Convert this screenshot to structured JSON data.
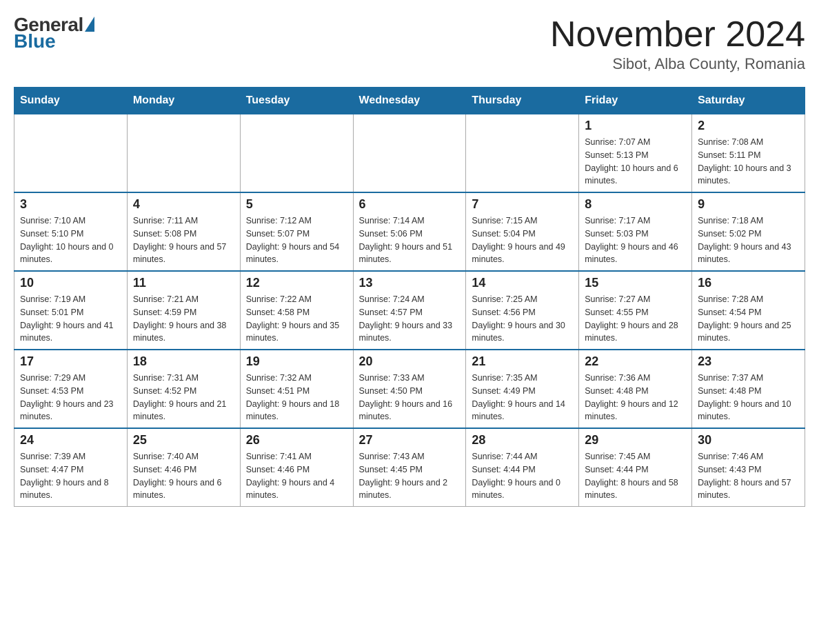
{
  "logo": {
    "general": "General",
    "blue": "Blue"
  },
  "title": {
    "month": "November 2024",
    "location": "Sibot, Alba County, Romania"
  },
  "weekdays": [
    "Sunday",
    "Monday",
    "Tuesday",
    "Wednesday",
    "Thursday",
    "Friday",
    "Saturday"
  ],
  "weeks": [
    [
      {
        "day": "",
        "info": ""
      },
      {
        "day": "",
        "info": ""
      },
      {
        "day": "",
        "info": ""
      },
      {
        "day": "",
        "info": ""
      },
      {
        "day": "",
        "info": ""
      },
      {
        "day": "1",
        "info": "Sunrise: 7:07 AM\nSunset: 5:13 PM\nDaylight: 10 hours and 6 minutes."
      },
      {
        "day": "2",
        "info": "Sunrise: 7:08 AM\nSunset: 5:11 PM\nDaylight: 10 hours and 3 minutes."
      }
    ],
    [
      {
        "day": "3",
        "info": "Sunrise: 7:10 AM\nSunset: 5:10 PM\nDaylight: 10 hours and 0 minutes."
      },
      {
        "day": "4",
        "info": "Sunrise: 7:11 AM\nSunset: 5:08 PM\nDaylight: 9 hours and 57 minutes."
      },
      {
        "day": "5",
        "info": "Sunrise: 7:12 AM\nSunset: 5:07 PM\nDaylight: 9 hours and 54 minutes."
      },
      {
        "day": "6",
        "info": "Sunrise: 7:14 AM\nSunset: 5:06 PM\nDaylight: 9 hours and 51 minutes."
      },
      {
        "day": "7",
        "info": "Sunrise: 7:15 AM\nSunset: 5:04 PM\nDaylight: 9 hours and 49 minutes."
      },
      {
        "day": "8",
        "info": "Sunrise: 7:17 AM\nSunset: 5:03 PM\nDaylight: 9 hours and 46 minutes."
      },
      {
        "day": "9",
        "info": "Sunrise: 7:18 AM\nSunset: 5:02 PM\nDaylight: 9 hours and 43 minutes."
      }
    ],
    [
      {
        "day": "10",
        "info": "Sunrise: 7:19 AM\nSunset: 5:01 PM\nDaylight: 9 hours and 41 minutes."
      },
      {
        "day": "11",
        "info": "Sunrise: 7:21 AM\nSunset: 4:59 PM\nDaylight: 9 hours and 38 minutes."
      },
      {
        "day": "12",
        "info": "Sunrise: 7:22 AM\nSunset: 4:58 PM\nDaylight: 9 hours and 35 minutes."
      },
      {
        "day": "13",
        "info": "Sunrise: 7:24 AM\nSunset: 4:57 PM\nDaylight: 9 hours and 33 minutes."
      },
      {
        "day": "14",
        "info": "Sunrise: 7:25 AM\nSunset: 4:56 PM\nDaylight: 9 hours and 30 minutes."
      },
      {
        "day": "15",
        "info": "Sunrise: 7:27 AM\nSunset: 4:55 PM\nDaylight: 9 hours and 28 minutes."
      },
      {
        "day": "16",
        "info": "Sunrise: 7:28 AM\nSunset: 4:54 PM\nDaylight: 9 hours and 25 minutes."
      }
    ],
    [
      {
        "day": "17",
        "info": "Sunrise: 7:29 AM\nSunset: 4:53 PM\nDaylight: 9 hours and 23 minutes."
      },
      {
        "day": "18",
        "info": "Sunrise: 7:31 AM\nSunset: 4:52 PM\nDaylight: 9 hours and 21 minutes."
      },
      {
        "day": "19",
        "info": "Sunrise: 7:32 AM\nSunset: 4:51 PM\nDaylight: 9 hours and 18 minutes."
      },
      {
        "day": "20",
        "info": "Sunrise: 7:33 AM\nSunset: 4:50 PM\nDaylight: 9 hours and 16 minutes."
      },
      {
        "day": "21",
        "info": "Sunrise: 7:35 AM\nSunset: 4:49 PM\nDaylight: 9 hours and 14 minutes."
      },
      {
        "day": "22",
        "info": "Sunrise: 7:36 AM\nSunset: 4:48 PM\nDaylight: 9 hours and 12 minutes."
      },
      {
        "day": "23",
        "info": "Sunrise: 7:37 AM\nSunset: 4:48 PM\nDaylight: 9 hours and 10 minutes."
      }
    ],
    [
      {
        "day": "24",
        "info": "Sunrise: 7:39 AM\nSunset: 4:47 PM\nDaylight: 9 hours and 8 minutes."
      },
      {
        "day": "25",
        "info": "Sunrise: 7:40 AM\nSunset: 4:46 PM\nDaylight: 9 hours and 6 minutes."
      },
      {
        "day": "26",
        "info": "Sunrise: 7:41 AM\nSunset: 4:46 PM\nDaylight: 9 hours and 4 minutes."
      },
      {
        "day": "27",
        "info": "Sunrise: 7:43 AM\nSunset: 4:45 PM\nDaylight: 9 hours and 2 minutes."
      },
      {
        "day": "28",
        "info": "Sunrise: 7:44 AM\nSunset: 4:44 PM\nDaylight: 9 hours and 0 minutes."
      },
      {
        "day": "29",
        "info": "Sunrise: 7:45 AM\nSunset: 4:44 PM\nDaylight: 8 hours and 58 minutes."
      },
      {
        "day": "30",
        "info": "Sunrise: 7:46 AM\nSunset: 4:43 PM\nDaylight: 8 hours and 57 minutes."
      }
    ]
  ]
}
